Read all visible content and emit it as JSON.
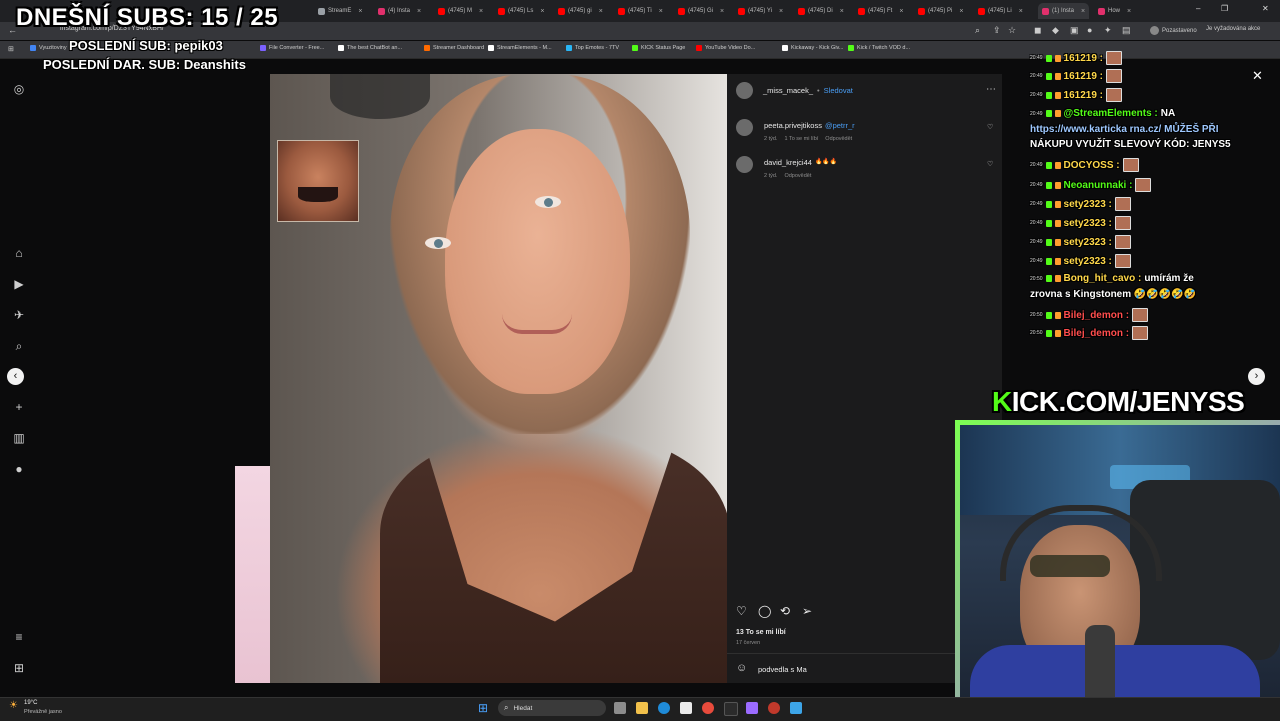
{
  "overlay": {
    "daily_subs": "DNEŠNÍ SUBS: 15 / 25",
    "last_sub": "POSLEDNÍ SUB: pepik03",
    "last_donation_sub": "POSLEDNÍ DAR. SUB: Deanshits"
  },
  "browser": {
    "url": "instagram.com/p/DZ3TY94NxBH/",
    "tabs": [
      {
        "label": "StreamE",
        "color": "#9aa0a6"
      },
      {
        "label": "(4) Insta",
        "color": "#e1306c"
      },
      {
        "label": "(4745) M",
        "color": "#ff0000"
      },
      {
        "label": "(4745) Ls",
        "color": "#ff0000"
      },
      {
        "label": "(4745) gi",
        "color": "#ff0000"
      },
      {
        "label": "(4745) Ti",
        "color": "#ff0000"
      },
      {
        "label": "(4745) Gi",
        "color": "#ff0000"
      },
      {
        "label": "(4745) Yi",
        "color": "#ff0000"
      },
      {
        "label": "(4745) Di",
        "color": "#ff0000"
      },
      {
        "label": "(4745) Ft",
        "color": "#ff0000"
      },
      {
        "label": "(4745) Pi",
        "color": "#ff0000"
      },
      {
        "label": "(4745) Li",
        "color": "#ff0000"
      },
      {
        "label": "(1) Insta",
        "color": "#e1306c",
        "active": true
      },
      {
        "label": "How",
        "color": "#e1306c"
      }
    ],
    "bookmarks": [
      {
        "label": "Vyuzitoviny",
        "color": "#4285f4"
      },
      {
        "label": "File Converter - Free...",
        "color": "#7b61ff"
      },
      {
        "label": "The best ChatBot an...",
        "color": "#ffffff"
      },
      {
        "label": "Streamer Dashboard",
        "color": "#ff6a00"
      },
      {
        "label": "StreamElements - M...",
        "color": "#ffffff"
      },
      {
        "label": "Top Emotes - 7TV",
        "color": "#29b6f6"
      },
      {
        "label": "KICK Status Page",
        "color": "#53fc18"
      },
      {
        "label": "YouTube Video Do...",
        "color": "#ff0000"
      },
      {
        "label": "Kickaway - Kick Giv...",
        "color": "#ffffff"
      },
      {
        "label": "Kick / Twitch VOD d...",
        "color": "#53fc18"
      }
    ],
    "paused_label": "Pozastaveno",
    "update_label": "Je vyžadována akce"
  },
  "post": {
    "author": "_miss_macek_",
    "follow_label": "Sledovat",
    "comments": [
      {
        "user": "peeta.privejtikoss",
        "mention": "@petrr_r",
        "time": "2 týd.",
        "likes": "1 To se mi líbí",
        "reply": "Odpovědět"
      },
      {
        "user": "david_krejci44",
        "text": "🔥🔥🔥",
        "time": "2 týd.",
        "reply": "Odpovědět"
      }
    ],
    "likes_count": "13 To se mi líbí",
    "date": "17 červen",
    "comment_input": "podvedla s Ma"
  },
  "chat": [
    {
      "time": "20:49",
      "user": "161219 :",
      "color": "#ffd84a",
      "text": ""
    },
    {
      "time": "20:49",
      "user": "161219 :",
      "color": "#ffd84a",
      "text": ""
    },
    {
      "time": "20:49",
      "user": "161219 :",
      "color": "#ffd84a",
      "text": ""
    },
    {
      "time": "20:49",
      "user": "@StreamElements :",
      "color": "#53fc18",
      "text": "NA"
    },
    {
      "time": "",
      "user": "",
      "color": "#9ec8ff",
      "text": "https://www.karticka rna.cz/ MŮŽEŠ PŘI"
    },
    {
      "time": "",
      "user": "",
      "color": "#ffffff",
      "text": "NÁKUPU VYUŽÍT SLEVOVÝ KÓD: JENYS5"
    },
    {
      "time": "20:49",
      "user": "DOCYOSS :",
      "color": "#ffd84a",
      "text": ""
    },
    {
      "time": "20:49",
      "user": "Neoanunnaki :",
      "color": "#53fc18",
      "text": ""
    },
    {
      "time": "20:49",
      "user": "sety2323 :",
      "color": "#ffd84a",
      "text": ""
    },
    {
      "time": "20:49",
      "user": "sety2323 :",
      "color": "#ffd84a",
      "text": ""
    },
    {
      "time": "20:49",
      "user": "sety2323 :",
      "color": "#ffd84a",
      "text": ""
    },
    {
      "time": "20:49",
      "user": "sety2323 :",
      "color": "#ffd84a",
      "text": ""
    },
    {
      "time": "20:50",
      "user": "Bong_hit_cavo :",
      "color": "#ffd84a",
      "text": "umírám že"
    },
    {
      "time": "",
      "user": "",
      "color": "#ffffff",
      "text": "zrovna s Kingstonem 🤣🤣🤣🤣🤣"
    },
    {
      "time": "20:50",
      "user": "Bilej_demon :",
      "color": "#ff4d4d",
      "text": ""
    },
    {
      "time": "20:50",
      "user": "Bilej_demon :",
      "color": "#ff4d4d",
      "text": ""
    }
  ],
  "kick_url": {
    "k": "K",
    "rest": "ICK.COM/JENYSS"
  },
  "taskbar": {
    "weather_temp": "19°C",
    "weather_desc": "Převážně jasno",
    "search_placeholder": "Hledat"
  }
}
